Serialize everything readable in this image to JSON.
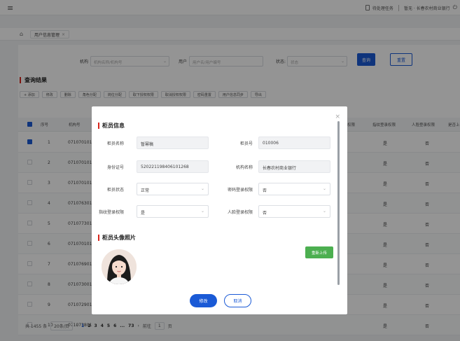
{
  "topbar": {
    "todo_label": "待处理任务",
    "user_label": "暂无 · 长春农村商业银行"
  },
  "tabs": [
    {
      "label": "用户信息管理"
    }
  ],
  "filters": {
    "org_label": "机构",
    "org_placeholder": "机构名称/机构号",
    "user_label": "用户",
    "user_placeholder": "用户名/用户编号",
    "status_label": "状态:",
    "status_placeholder": "状态",
    "search_btn": "查询",
    "reset_btn": "重置"
  },
  "results": {
    "title": "查询结果",
    "toolbar": [
      "+ 添加",
      "修改",
      "删除",
      "角色分配",
      "岗位分配",
      "取下授权权限",
      "取消授权权限",
      "密码重置",
      "用户信息同步",
      "导出"
    ]
  },
  "table": {
    "headers": [
      "序号",
      "机构号",
      "",
      "",
      "",
      "",
      "权限",
      "指纹登录权限",
      "人脸登录权限",
      "是否上"
    ],
    "rows": [
      {
        "no": "1",
        "org": "071070101",
        "fp": "是",
        "face": "否",
        "checked": true
      },
      {
        "no": "2",
        "org": "071070101",
        "fp": "是",
        "face": "否",
        "checked": false
      },
      {
        "no": "3",
        "org": "071070101",
        "fp": "是",
        "face": "否",
        "checked": false
      },
      {
        "no": "4",
        "org": "071076301",
        "fp": "是",
        "face": "否",
        "checked": false
      },
      {
        "no": "5",
        "org": "071077301",
        "fp": "是",
        "face": "否",
        "checked": false
      },
      {
        "no": "6",
        "org": "071070101",
        "fp": "是",
        "face": "否",
        "checked": false
      },
      {
        "no": "7",
        "org": "071076901",
        "fp": "是",
        "face": "否",
        "checked": false
      },
      {
        "no": "8",
        "org": "071073001",
        "fp": "是",
        "face": "否",
        "checked": false
      },
      {
        "no": "9",
        "org": "071072901",
        "fp": "是",
        "face": "否",
        "checked": false
      },
      {
        "no": "10",
        "org": "071073801",
        "fp": "是",
        "face": "否",
        "checked": false
      }
    ]
  },
  "pager": {
    "total": "共 1455 条",
    "page_size": "20条/页",
    "pages": [
      "1",
      "2",
      "3",
      "4",
      "5",
      "6",
      "...",
      "73"
    ],
    "goto_label": "前往",
    "goto_value": "1",
    "page_suffix": "页"
  },
  "modal": {
    "section1_title": "柜员信息",
    "fields": {
      "teller_name_label": "柜员名称",
      "teller_name_value": "暂幂稿",
      "teller_no_label": "柜员号",
      "teller_no_value": "010006",
      "id_no_label": "身份证号",
      "id_no_value": "520221198406101268",
      "org_name_label": "机构名称",
      "org_name_value": "长春农村商业银行",
      "status_label": "柜员状态",
      "status_value": "正常",
      "pwd_login_label": "密码登录权限",
      "pwd_login_value": "否",
      "fp_login_label": "指纹登录权限",
      "fp_login_value": "是",
      "face_login_label": "人脸登录权限",
      "face_login_value": "否"
    },
    "section2_title": "柜员头像照片",
    "upload_btn": "重新上传",
    "modify_btn": "修改",
    "cancel_btn": "取消"
  },
  "colors": {
    "primary": "#1a5ad6",
    "accent_red": "#d9251c",
    "upload_green": "#4caf50"
  }
}
